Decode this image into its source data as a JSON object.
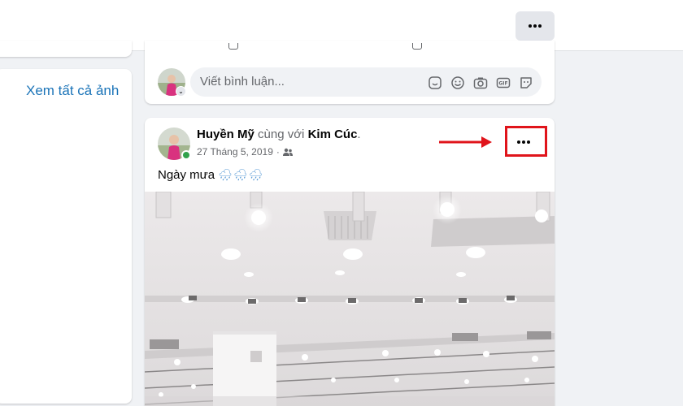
{
  "topbar": {
    "more_icon": "more-horizontal-icon"
  },
  "sidebar": {
    "see_all_photos": "Xem tất cả ảnh"
  },
  "comment": {
    "placeholder": "Viết bình luận...",
    "icons": [
      "sticker-icon",
      "emoji-icon",
      "camera-icon",
      "gif-icon",
      "sticker-alt-icon"
    ]
  },
  "post": {
    "author": "Huyền Mỹ",
    "with_text": "cùng với",
    "tagged": "Kim Cúc",
    "date": "27 Tháng 5, 2019",
    "dot": "·",
    "audience_icon": "friends-icon",
    "text": "Ngày mưa",
    "rain_emoji": "🌧🌧🌧"
  },
  "colors": {
    "annotation": "#e0141b",
    "link": "#1b74b8",
    "online": "#31a24c"
  }
}
